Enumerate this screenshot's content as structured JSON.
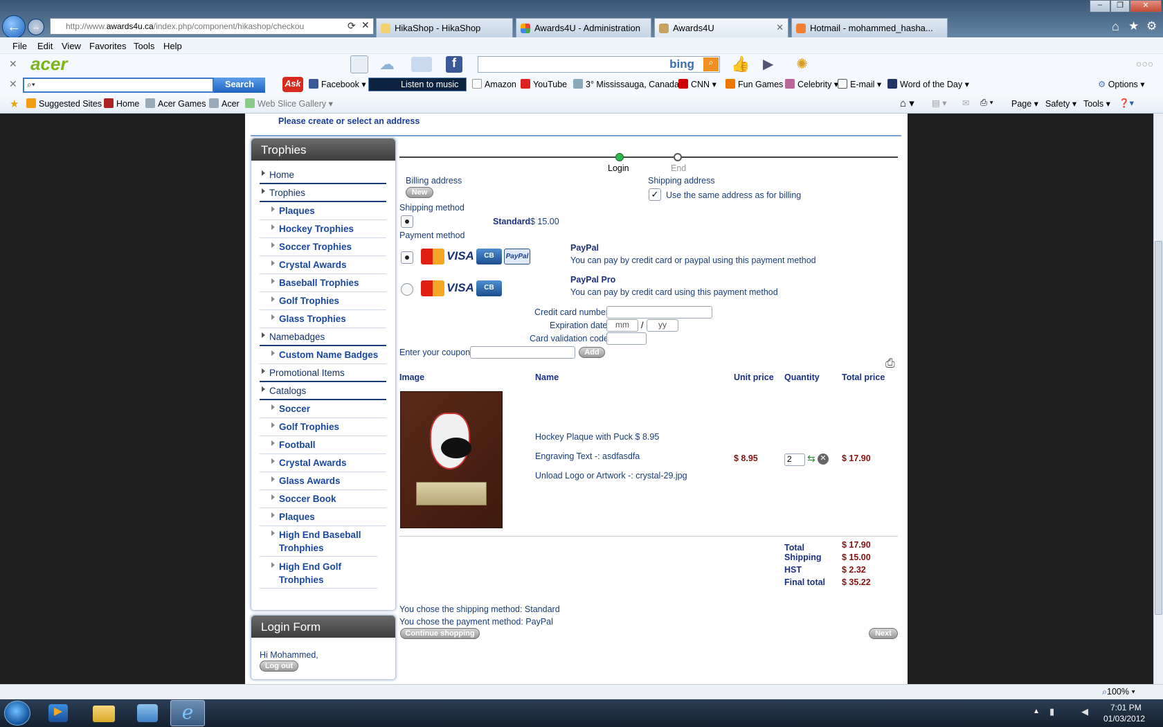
{
  "browser": {
    "address": {
      "prefix": "http://www.",
      "domain": "awards4u.ca",
      "path": "/index.php/component/hikashop/checkou"
    },
    "tabs": [
      {
        "label": "HikaShop - HikaShop",
        "active": false
      },
      {
        "label": "Awards4U - Administration",
        "active": false
      },
      {
        "label": "Awards4U",
        "active": true
      },
      {
        "label": "Hotmail - mohammed_hasha...",
        "active": false
      }
    ],
    "menu": [
      "File",
      "Edit",
      "View",
      "Favorites",
      "Tools",
      "Help"
    ],
    "acer_logo": "acer",
    "bing_label": "bing",
    "ask": {
      "search_label": "Search",
      "ask_label": "Ask",
      "facebook": "Facebook",
      "music": "Listen to music",
      "amazon": "Amazon",
      "youtube": "YouTube",
      "weather": "3° Mississauga, Canada",
      "cnn": "CNN",
      "fungames": "Fun Games",
      "celebrity": "Celebrity",
      "email": "E-mail",
      "wotd": "Word of the Day",
      "options": "Options"
    },
    "favorites": {
      "suggested": "Suggested Sites",
      "home": "Home",
      "acer_games": "Acer Games",
      "acer": "Acer",
      "web_slice": "Web Slice Gallery"
    },
    "cmd": {
      "page": "Page",
      "safety": "Safety",
      "tools": "Tools"
    },
    "zoom": "100%"
  },
  "page": {
    "notice": "Please create or select an address",
    "sidebar": {
      "title": "Trophies",
      "items": [
        {
          "label": "Home",
          "level": 1
        },
        {
          "label": "Trophies",
          "level": 1
        },
        {
          "label": "Plaques",
          "level": 2
        },
        {
          "label": "Hockey Trophies",
          "level": 2
        },
        {
          "label": "Soccer Trophies",
          "level": 2
        },
        {
          "label": "Crystal Awards",
          "level": 2
        },
        {
          "label": "Baseball Trophies",
          "level": 2
        },
        {
          "label": "Golf Trophies",
          "level": 2
        },
        {
          "label": "Glass Trophies",
          "level": 2
        },
        {
          "label": "Namebadges",
          "level": 1
        },
        {
          "label": "Custom Name Badges",
          "level": 2
        },
        {
          "label": "Promotional Items",
          "level": 1
        },
        {
          "label": "Catalogs",
          "level": 1
        },
        {
          "label": "Soccer",
          "level": 2
        },
        {
          "label": "Golf Trophies",
          "level": 2
        },
        {
          "label": "Football",
          "level": 2
        },
        {
          "label": "Crystal Awards",
          "level": 2
        },
        {
          "label": "Glass Awards",
          "level": 2
        },
        {
          "label": "Soccer Book",
          "level": 2
        },
        {
          "label": "Plaques",
          "level": 2
        },
        {
          "label": "High End Baseball Trohphies",
          "level": 2
        },
        {
          "label": "High End Golf Trohphies",
          "level": 2
        }
      ]
    },
    "login": {
      "title": "Login Form",
      "greeting": "Hi Mohammed,",
      "logout": "Log out"
    },
    "steps": [
      {
        "label": "Login",
        "done": true
      },
      {
        "label": "End",
        "done": false
      }
    ],
    "billing": {
      "label": "Billing address",
      "new_btn": "New"
    },
    "shipping_addr": {
      "label": "Shipping address",
      "same_label": "Use the same address as for billing",
      "checked": true
    },
    "shipping_method": {
      "label": "Shipping method",
      "name": "Standard",
      "price": "$ 15.00"
    },
    "payment": {
      "label": "Payment method",
      "options": [
        {
          "name": "PayPal",
          "desc": "You can pay by credit card or paypal using this payment method",
          "selected": true,
          "cards": [
            "MasterCard",
            "VISA",
            "CB",
            "PayPal"
          ]
        },
        {
          "name": "PayPal Pro",
          "desc": "You can pay by credit card using this payment method",
          "selected": false,
          "cards": [
            "MasterCard",
            "VISA",
            "CB"
          ]
        }
      ],
      "cc_number_label": "Credit card number",
      "exp_label": "Expiration date",
      "mm_placeholder": "mm",
      "yy_placeholder": "yy",
      "cvc_label": "Card validation code"
    },
    "coupon": {
      "label": "Enter your coupon",
      "add_btn": "Add"
    },
    "cart": {
      "headers": {
        "image": "Image",
        "name": "Name",
        "unit": "Unit price",
        "qty": "Quantity",
        "total": "Total price"
      },
      "item": {
        "title": "Hockey Plaque with Puck $ 8.95",
        "engraving": "Engraving Text -: asdfasdfa",
        "logo": "Unload Logo or Artwork -: crystal-29.jpg",
        "unit": "$ 8.95",
        "qty": "2",
        "total": "$ 17.90"
      }
    },
    "totals": [
      {
        "label": "Total",
        "value": "$ 17.90"
      },
      {
        "label": "Shipping",
        "value": "$ 15.00"
      },
      {
        "label": "HST",
        "value": "$ 2.32"
      },
      {
        "label": "Final total",
        "value": "$ 35.22"
      }
    ],
    "chosen_shipping": "You chose the shipping method: Standard",
    "chosen_payment": "You chose the payment method: PayPal",
    "continue_btn": "Continue shopping",
    "next_btn": "Next"
  },
  "taskbar": {
    "time": "7:01 PM",
    "date": "01/03/2012"
  }
}
